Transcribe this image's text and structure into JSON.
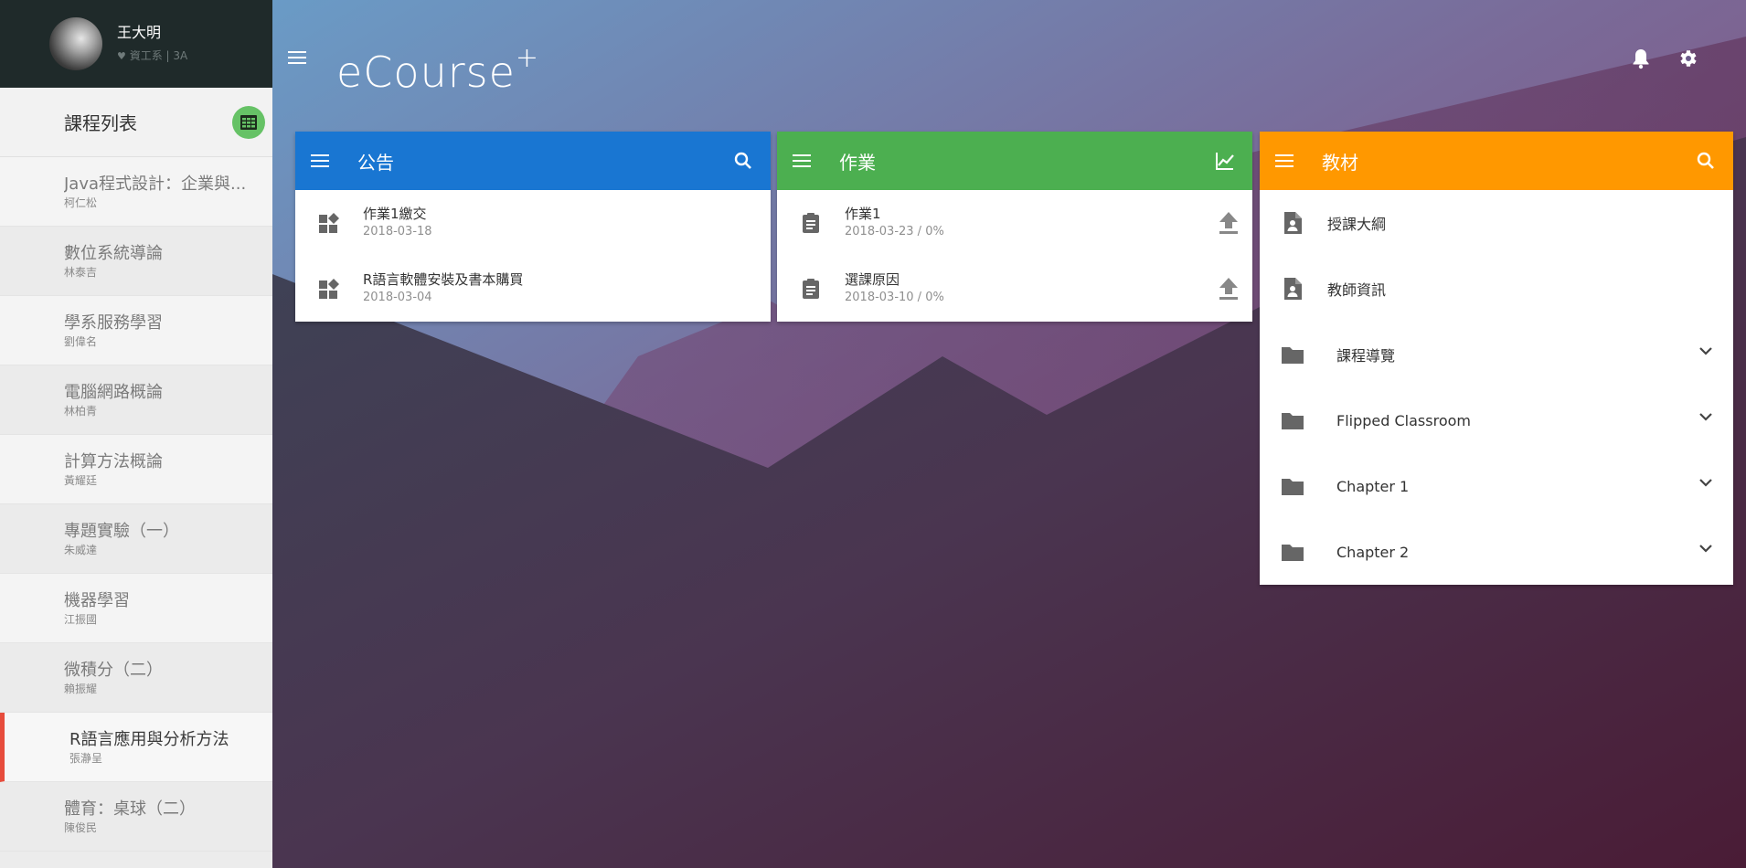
{
  "app": {
    "logo_text": "eCourse",
    "logo_sup": "+"
  },
  "user": {
    "name": "王大明",
    "dept": "資工系 | 3A"
  },
  "sidebar": {
    "title": "課程列表",
    "courses": [
      {
        "name": "Java程式設計：企業與...",
        "teacher": "柯仁松"
      },
      {
        "name": "數位系統導論",
        "teacher": "林泰吉"
      },
      {
        "name": "學系服務學習",
        "teacher": "劉偉名"
      },
      {
        "name": "電腦網路概論",
        "teacher": "林柏青"
      },
      {
        "name": "計算方法概論",
        "teacher": "黃耀廷"
      },
      {
        "name": "專題實驗（一）",
        "teacher": "朱威達"
      },
      {
        "name": "機器學習",
        "teacher": "江振國"
      },
      {
        "name": "微積分（二）",
        "teacher": "賴振耀"
      },
      {
        "name": "R語言應用與分析方法",
        "teacher": "張瀞呈",
        "active": true
      },
      {
        "name": "體育：桌球（二）",
        "teacher": "陳俊民"
      }
    ]
  },
  "announcements": {
    "title": "公告",
    "color": "#1976d2",
    "items": [
      {
        "title": "作業1繳交",
        "date": "2018-03-18"
      },
      {
        "title": "R語言軟體安裝及書本購買",
        "date": "2018-03-04"
      }
    ]
  },
  "homework": {
    "title": "作業",
    "color": "#4caf50",
    "items": [
      {
        "title": "作業1",
        "sub": "2018-03-23 / 0%"
      },
      {
        "title": "選課原因",
        "sub": "2018-03-10 / 0%"
      }
    ]
  },
  "materials": {
    "title": "教材",
    "color": "#ff9800",
    "items": [
      {
        "title": "授課大綱",
        "kind": "file"
      },
      {
        "title": "教師資訊",
        "kind": "file"
      },
      {
        "title": "課程導覽",
        "kind": "folder"
      },
      {
        "title": "Flipped Classroom",
        "kind": "folder"
      },
      {
        "title": "Chapter 1",
        "kind": "folder"
      },
      {
        "title": "Chapter 2",
        "kind": "folder"
      }
    ]
  }
}
